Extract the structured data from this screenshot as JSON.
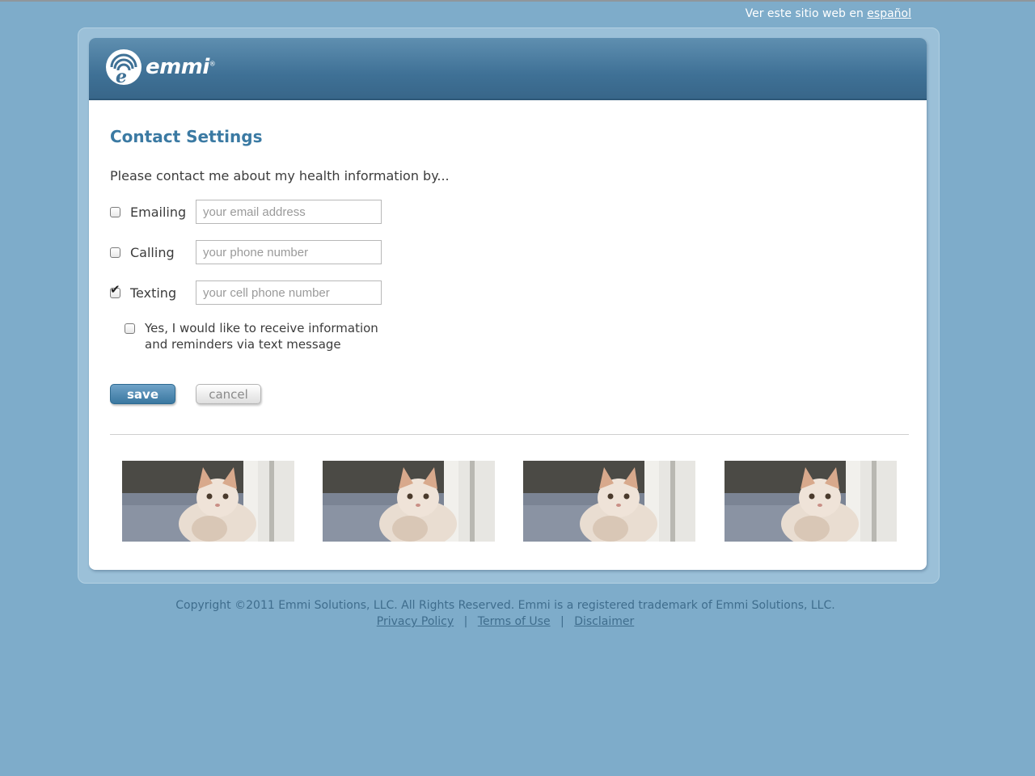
{
  "language_link": {
    "prefix": "Ver este sitio web en",
    "link": "español"
  },
  "brand": {
    "name": "emmi",
    "mark": "®"
  },
  "page": {
    "title": "Contact Settings",
    "intro": "Please contact me about my health information by..."
  },
  "contact_methods": [
    {
      "label": "Emailing",
      "placeholder": "your email address",
      "checked": false
    },
    {
      "label": "Calling",
      "placeholder": "your phone number",
      "checked": false
    },
    {
      "label": "Texting",
      "placeholder": "your cell phone number",
      "checked": true
    }
  ],
  "consent": {
    "line1": "Yes, I would like to receive information",
    "line2": "and reminders via text message",
    "checked": false
  },
  "buttons": {
    "save": "save",
    "cancel": "cancel"
  },
  "photos": [
    "kitten-photo",
    "kitten-photo",
    "kitten-photo",
    "kitten-photo"
  ],
  "footer": {
    "copyright": "Copyright ©2011 Emmi Solutions, LLC. All Rights Reserved. Emmi is a registered trademark of Emmi Solutions, LLC.",
    "links": [
      "Privacy Policy",
      "Terms of Use",
      "Disclaimer"
    ],
    "separator": "|"
  },
  "colors": {
    "background": "#7eacca",
    "header": "#3f7196",
    "accent": "#3b7aa3"
  }
}
